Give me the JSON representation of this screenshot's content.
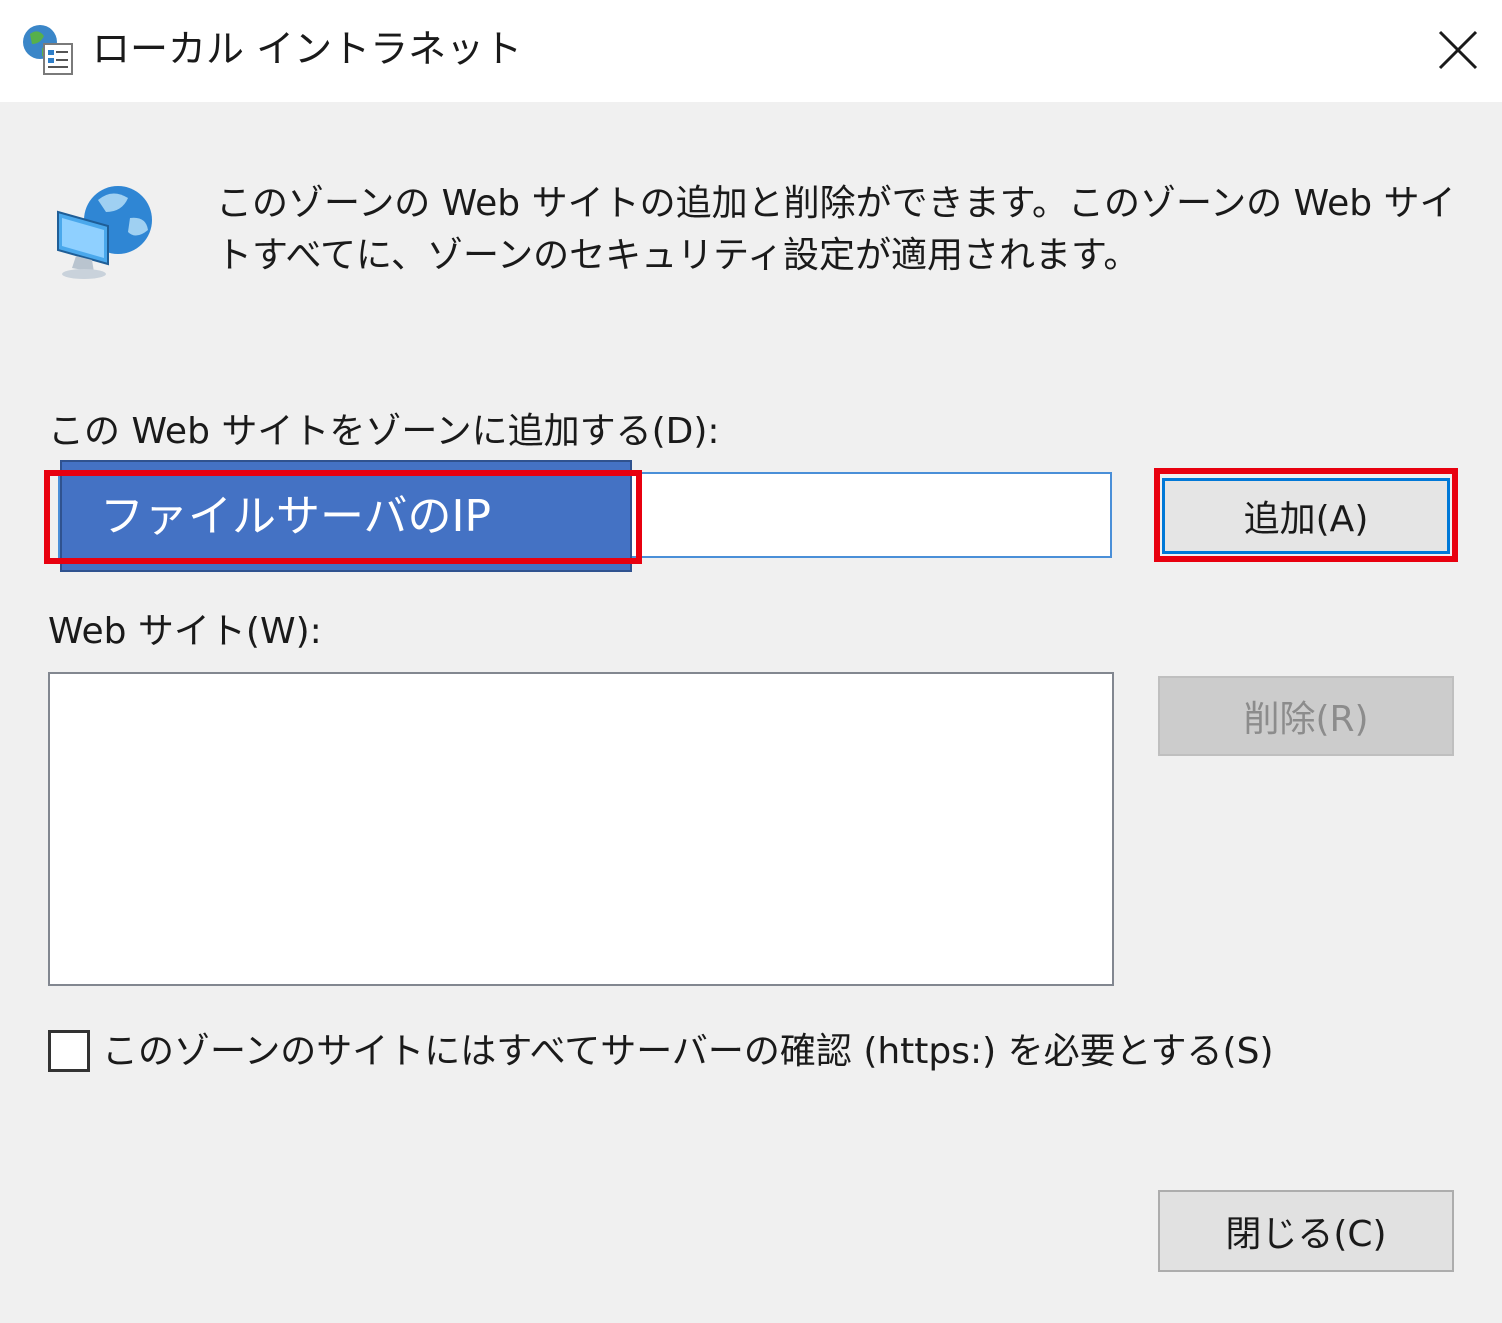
{
  "window": {
    "title": "ローカル イントラネット",
    "title_icon": "globe-document-icon",
    "close_icon": "close-icon"
  },
  "dialog": {
    "zone_icon": "globe-monitor-icon",
    "description": "このゾーンの Web サイトの追加と削除ができます。このゾーンの Web サイトすべてに、ゾーンのセキュリティ設定が適用されます。",
    "add_label": "この Web サイトをゾーンに追加する(D):",
    "url_input_value": "",
    "add_button": "追加(A)",
    "websites_label": "Web サイト(W):",
    "websites": [],
    "remove_button": "削除(R)",
    "require_https_label": "このゾーンのサイトにはすべてサーバーの確認 (https:) を必要とする(S)",
    "require_https_checked": false,
    "close_button": "閉じる(C)"
  },
  "annotation": {
    "overlay_text": "ファイルサーバのIP",
    "overlay_color": "#4472c4",
    "highlight_color": "#e8000f"
  }
}
